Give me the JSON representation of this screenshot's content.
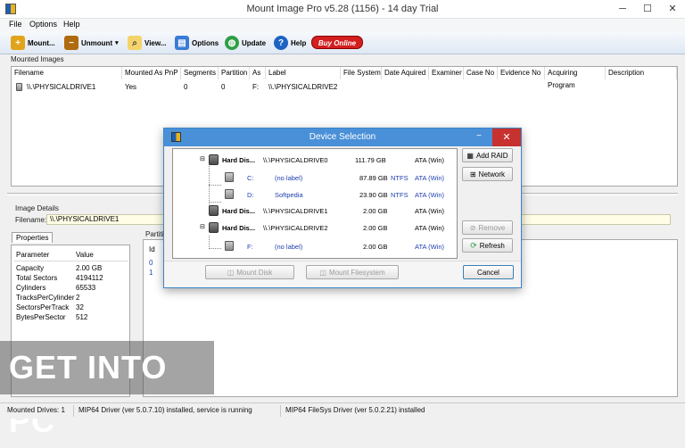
{
  "window": {
    "title": "Mount Image Pro v5.28 (1156) - 14 day Trial",
    "minimize": "─",
    "maximize": "☐",
    "close": "✕"
  },
  "menu": [
    "File",
    "Options",
    "Help"
  ],
  "toolbar": {
    "mount": "Mount...",
    "unmount": "Unmount",
    "view": "View...",
    "options": "Options",
    "update": "Update",
    "help": "Help",
    "buy": "Buy Online"
  },
  "mounted": {
    "label": "Mounted Images",
    "columns": [
      "Filename",
      "Mounted As PnP",
      "Segments",
      "Partition",
      "As",
      "Label",
      "File System",
      "Date Aquired",
      "Examiner",
      "Case No",
      "Evidence No",
      "Acquiring Program",
      "Description"
    ],
    "rows": [
      [
        "\\\\.\\PHYSICALDRIVE1",
        "Yes",
        "0",
        "0",
        "F:",
        "\\\\.\\PHYSICALDRIVE2",
        "",
        "",
        "",
        "",
        "",
        "",
        ""
      ]
    ]
  },
  "details": {
    "label": "Image Details",
    "filename_label": "Filename:",
    "filename_value": "\\\\.\\PHYSICALDRIVE1",
    "properties_tab": "Properties",
    "partitions_tab": "Partiti",
    "param_header": "Parameter",
    "value_header": "Value",
    "properties": [
      [
        "Capacity",
        "2.00 GB"
      ],
      [
        "Total Sectors",
        "4194112"
      ],
      [
        "Cylinders",
        "65533"
      ],
      [
        "TracksPerCylinder",
        "2"
      ],
      [
        "SectorsPerTrack",
        "32"
      ],
      [
        "BytesPerSector",
        "512"
      ]
    ],
    "partition_id_header": "Id",
    "partition_ids": [
      "0",
      "1"
    ]
  },
  "dialog": {
    "title": "Device Selection",
    "tree": [
      {
        "type": "drive",
        "name": "Hard Dis...",
        "device": "\\\\.\\PHYSICALDRIVE0",
        "size": "111.79 GB",
        "fs": "",
        "bus": "ATA (Win)"
      },
      {
        "type": "part",
        "name": "C:",
        "device": "(no label)",
        "size": "87.89 GB",
        "fs": "NTFS",
        "bus": "ATA (Win)"
      },
      {
        "type": "part",
        "name": "D:",
        "device": "Softpedia",
        "size": "23.90 GB",
        "fs": "NTFS",
        "bus": "ATA (Win)"
      },
      {
        "type": "drive",
        "name": "Hard Dis...",
        "device": "\\\\.\\PHYSICALDRIVE1",
        "size": "2.00 GB",
        "fs": "",
        "bus": "ATA (Win)"
      },
      {
        "type": "drive",
        "name": "Hard Dis...",
        "device": "\\\\.\\PHYSICALDRIVE2",
        "size": "2.00 GB",
        "fs": "",
        "bus": "ATA (Win)"
      },
      {
        "type": "part",
        "name": "F:",
        "device": "(no label)",
        "size": "2.00 GB",
        "fs": "",
        "bus": "ATA (Win)"
      }
    ],
    "add_raid": "Add RAID",
    "network": "Network",
    "remove": "Remove",
    "refresh": "Refresh",
    "mount_disk": "Mount Disk",
    "mount_filesystem": "Mount Filesystem",
    "cancel": "Cancel"
  },
  "status": {
    "mounted_drives": "Mounted Drives: 1",
    "driver": "MIP64 Driver (ver 5.0.7.10) installed, service is running",
    "fs_driver": "MIP64 FileSys Driver (ver 5.0.2.21) installed"
  },
  "watermark": "GET INTO PC"
}
